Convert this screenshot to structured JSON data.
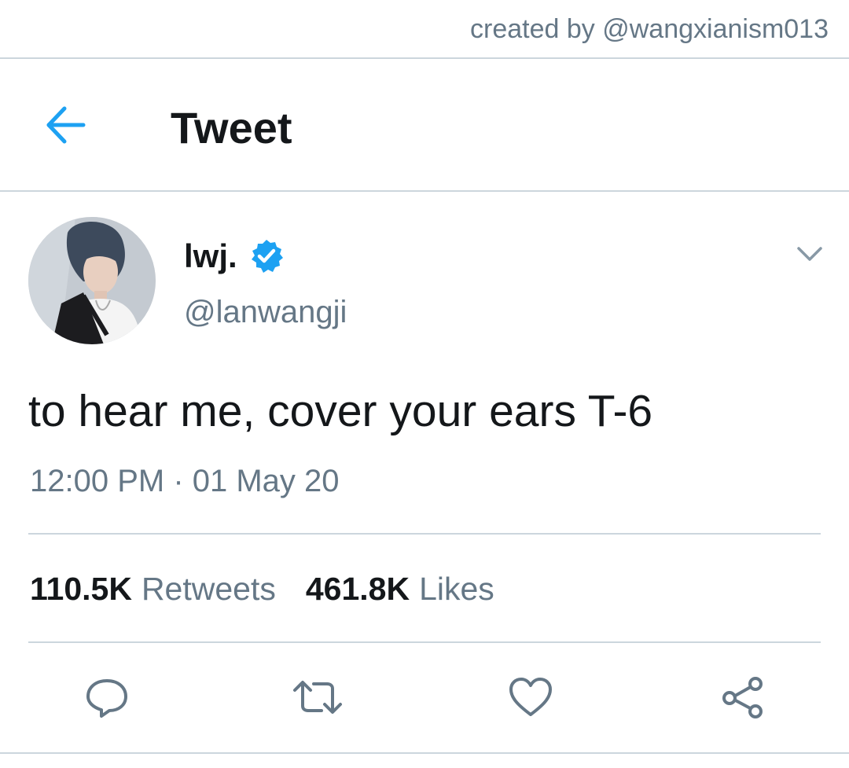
{
  "credit": "created by @wangxianism013",
  "header": {
    "title": "Tweet",
    "back_icon": "arrow-left-icon"
  },
  "tweet": {
    "author": {
      "display_name": "lwj.",
      "verified": true,
      "handle": "@lanwangji"
    },
    "text": "to hear me, cover your ears T-6",
    "timestamp": "12:00 PM · 01 May 20",
    "stats": {
      "retweets_count": "110.5K",
      "retweets_label": "Retweets",
      "likes_count": "461.8K",
      "likes_label": "Likes"
    },
    "actions": [
      "reply-icon",
      "retweet-icon",
      "like-icon",
      "share-icon"
    ]
  },
  "colors": {
    "accent": "#1da1f2",
    "text_primary": "#14171a",
    "text_secondary": "#657786",
    "divider": "#ccd6dd"
  }
}
